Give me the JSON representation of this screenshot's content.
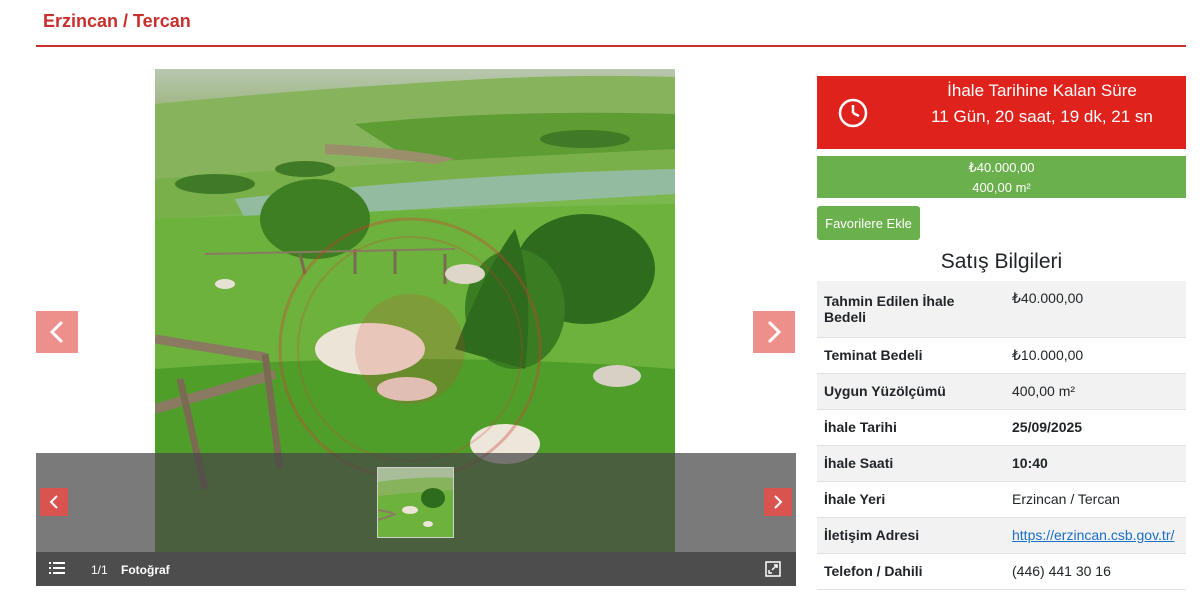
{
  "page": {
    "title": "Erzincan / Tercan"
  },
  "gallery": {
    "counter": "1/1",
    "caption": "Fotoğraf",
    "icons": {
      "prev": "chevron-left-icon",
      "next": "chevron-right-icon",
      "list": "list-icon",
      "fullscreen": "expand-icon"
    }
  },
  "countdown": {
    "label": "İhale Tarihine Kalan Süre",
    "value": "11 Gün, 20 saat, 19 dk, 21 sn",
    "icon": "clock-icon"
  },
  "price": {
    "amount": "₺40.000,00",
    "area": "400,00 m²"
  },
  "favorite_button": "Favorilere Ekle",
  "sales_info": {
    "heading": "Satış Bilgileri",
    "rows": [
      {
        "label": "Tahmin Edilen İhale Bedeli",
        "value": "₺40.000,00"
      },
      {
        "label": "Teminat Bedeli",
        "value": "₺10.000,00"
      },
      {
        "label": "Uygun Yüzölçümü",
        "value": "400,00 m²"
      },
      {
        "label": "İhale Tarihi",
        "value": "25/09/2025"
      },
      {
        "label": "İhale Saati",
        "value": "10:40"
      },
      {
        "label": "İhale Yeri",
        "value": "Erzincan / Tercan"
      },
      {
        "label": "İletişim Adresi",
        "value": "https://erzincan.csb.gov.tr/"
      },
      {
        "label": "Telefon / Dahili",
        "value": "(446) 441 30 16"
      }
    ]
  },
  "colors": {
    "brand_red": "#c8302e",
    "timer_red": "#e0221d",
    "green": "#6ab04c",
    "nav_pink": "#ed8f8a",
    "link_blue": "#1a6fc6"
  }
}
